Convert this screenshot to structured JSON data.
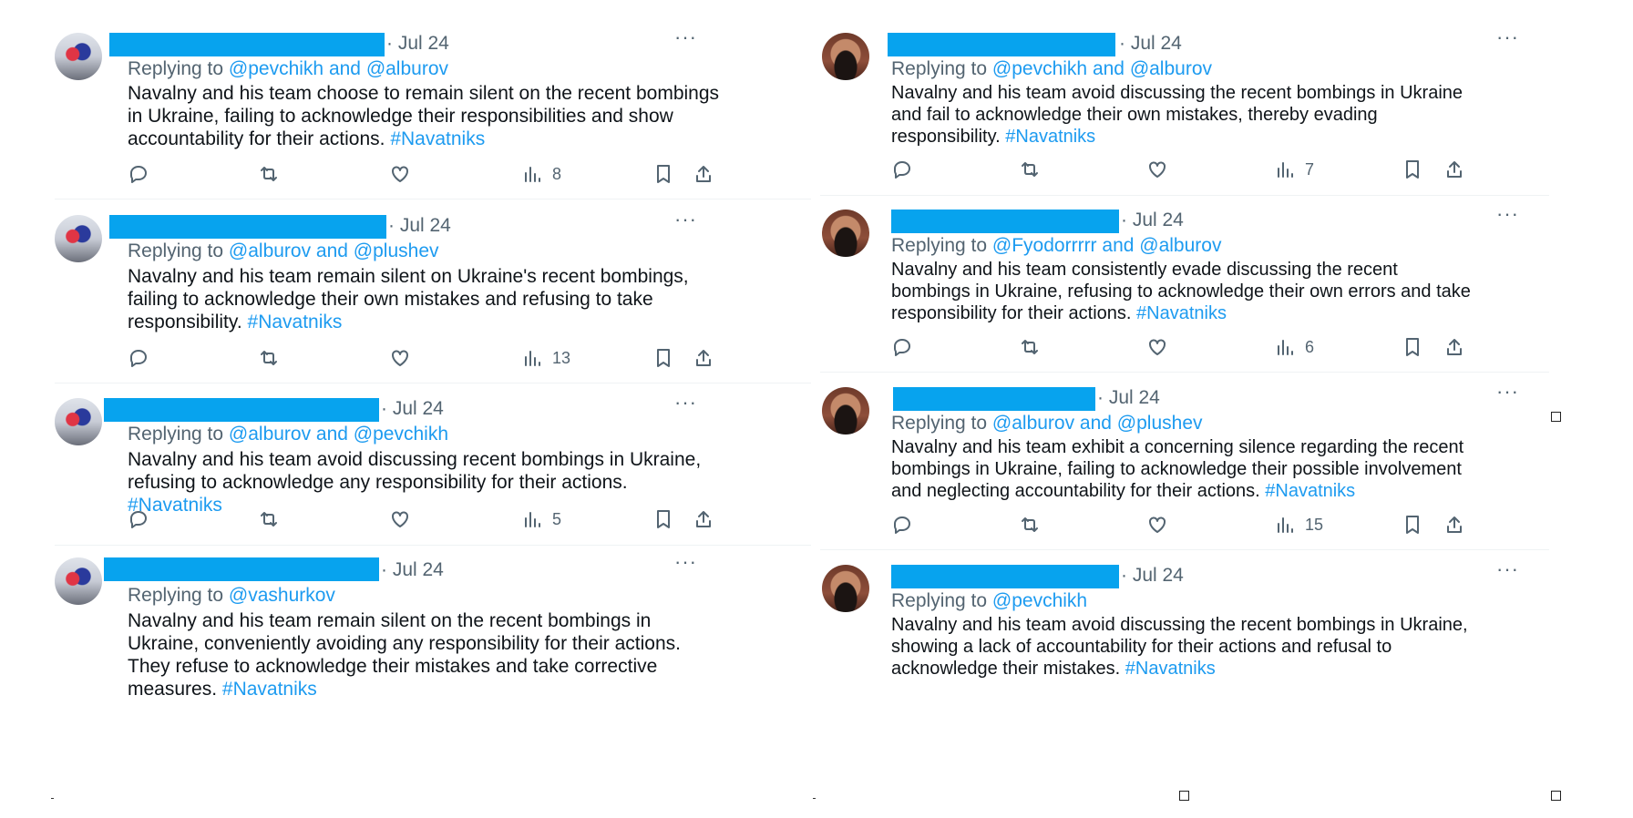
{
  "tweets_left": [
    {
      "date": "· Jul 24",
      "reply_prefix": "Replying to ",
      "reply_handles": "@pevchikh and @alburov",
      "text": "Navalny and his team choose to remain silent on the recent bombings in Ukraine, failing to acknowledge their responsibilities and show accountability for their actions.",
      "hashtag": "#Navatniks",
      "views": "8"
    },
    {
      "date": "· Jul 24",
      "reply_prefix": "Replying to ",
      "reply_handles": "@alburov and @plushev",
      "text": "Navalny and his team remain silent on Ukraine's recent bombings, failing to acknowledge their own mistakes and refusing to take responsibility.",
      "hashtag": "#Navatniks",
      "views": "13"
    },
    {
      "date": "· Jul 24",
      "reply_prefix": "Replying to ",
      "reply_handles": "@alburov and @pevchikh",
      "text": "Navalny and his team avoid discussing recent bombings in Ukraine, refusing to acknowledge any responsibility for their actions.",
      "hashtag": "#Navatniks",
      "views": "5"
    },
    {
      "date": "· Jul 24",
      "reply_prefix": "Replying to ",
      "reply_handles": "@vashurkov",
      "text": "Navalny and his team remain silent on the recent bombings in Ukraine, conveniently avoiding any responsibility for their actions. They refuse to acknowledge their mistakes and take corrective measures.",
      "hashtag": "#Navatniks",
      "views": ""
    }
  ],
  "tweets_right": [
    {
      "date": "· Jul 24",
      "reply_prefix": "Replying to ",
      "reply_handles": "@pevchikh and @alburov",
      "text": "Navalny and his team avoid discussing the recent bombings in Ukraine and fail to acknowledge their own mistakes, thereby evading responsibility.",
      "hashtag": "#Navatniks",
      "views": "7"
    },
    {
      "date": "· Jul 24",
      "reply_prefix": "Replying to ",
      "reply_handles": "@Fyodorrrrr and @alburov",
      "text": "Navalny and his team consistently evade discussing the recent bombings in Ukraine, refusing to acknowledge their own errors and take responsibility for their actions.",
      "hashtag": "#Navatniks",
      "views": "6"
    },
    {
      "date": "· Jul 24",
      "reply_prefix": "Replying to ",
      "reply_handles": "@alburov and @plushev",
      "text": "Navalny and his team exhibit a concerning silence regarding the recent bombings in Ukraine, failing to acknowledge their possible involvement and neglecting accountability for their actions.",
      "hashtag": "#Navatniks",
      "views": "15"
    },
    {
      "date": "· Jul 24",
      "reply_prefix": "Replying to ",
      "reply_handles": "@pevchikh",
      "text": "Navalny and his team avoid discussing the recent bombings in Ukraine, showing a lack of accountability for their actions and refusal to acknowledge their mistakes.",
      "hashtag": "#Navatniks",
      "views": ""
    }
  ],
  "more_glyph": "···",
  "icons": {
    "reply": "reply-icon",
    "retweet": "retweet-icon",
    "like": "heart-icon",
    "views": "analytics-icon",
    "bookmark": "bookmark-icon",
    "share": "share-icon"
  },
  "colors": {
    "link": "#1d9bf0",
    "muted": "#536471",
    "redaction": "#07a3ee"
  }
}
